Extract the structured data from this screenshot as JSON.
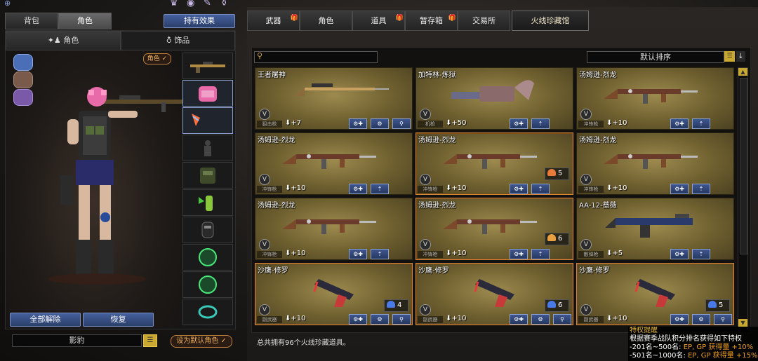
{
  "colors": {
    "accent_gold": "#d4a83a",
    "card_bg": "#8a7a42",
    "button_blue": "#34508a",
    "highlight_border": "#d48a3a"
  },
  "left": {
    "tabs": [
      "背包",
      "角色"
    ],
    "effects_button": "持有效果",
    "subtabs": [
      "角色",
      "饰品"
    ],
    "role_badge": "角色",
    "slot_icons": [
      "rifle-slot-icon",
      "backpack-slot-icon",
      "shield-slot-icon",
      "silhouette-slot-icon",
      "vest-slot-icon",
      "grenade-slot-icon",
      "mask-slot-icon",
      "emblem-slot-icon",
      "emblem-slot-icon",
      "ring-slot-icon"
    ],
    "remove_all": "全部解除",
    "restore": "恢复",
    "character_name": "影豹",
    "set_default": "设为默认角色"
  },
  "right": {
    "tabs": [
      "武器",
      "角色",
      "道具",
      "暂存箱",
      "交易所",
      "火线珍藏馆"
    ],
    "tabs_with_gift": [
      0,
      2,
      3
    ],
    "active_tab": "火线珍藏馆",
    "search_placeholder": "",
    "sort_label": "默认排序",
    "items": [
      {
        "name": "王者屠神",
        "type": "狙击枪",
        "level": "+7",
        "count": "",
        "gun": "sniper"
      },
      {
        "name": "加特林-炼狱",
        "type": "机枪",
        "level": "+50",
        "count": "",
        "gun": "gatling"
      },
      {
        "name": "汤姆逊-烈龙",
        "type": "冲锋枪",
        "level": "+10",
        "count": "",
        "gun": "tommy"
      },
      {
        "name": "汤姆逊-烈龙",
        "type": "冲锋枪",
        "level": "+10",
        "count": "",
        "gun": "tommy"
      },
      {
        "name": "汤姆逊-烈龙",
        "type": "冲锋枪",
        "level": "+10",
        "count": "5",
        "gun": "tommy"
      },
      {
        "name": "汤姆逊-烈龙",
        "type": "冲锋枪",
        "level": "+10",
        "count": "",
        "gun": "tommy"
      },
      {
        "name": "汤姆逊-烈龙",
        "type": "冲锋枪",
        "level": "+10",
        "count": "",
        "gun": "tommy"
      },
      {
        "name": "汤姆逊-烈龙",
        "type": "冲锋枪",
        "level": "+10",
        "count": "6",
        "gun": "tommy"
      },
      {
        "name": "AA-12-蔷薇",
        "type": "散弹枪",
        "level": "+5",
        "count": "",
        "gun": "shotgun"
      },
      {
        "name": "沙鹰-修罗",
        "type": "副武器",
        "level": "+10",
        "count": "4",
        "gun": "pistol"
      },
      {
        "name": "沙鹰-修罗",
        "type": "副武器",
        "level": "+10",
        "count": "6",
        "gun": "pistol"
      },
      {
        "name": "沙鹰-修罗",
        "type": "副武器",
        "level": "+10",
        "count": "5",
        "gun": "pistol"
      }
    ],
    "footer": "总共拥有96个火线珍藏道具。",
    "notice": {
      "title": "特权提醒",
      "line1": "根据赛季战队积分排名获得如下特权",
      "line2_pre": "-201名~500名: ",
      "line2_val": "EP, GP 获得量 +10%",
      "line3_pre": "-501名~1000名: ",
      "line3_val": "EP, GP 获得量 +15%"
    }
  }
}
